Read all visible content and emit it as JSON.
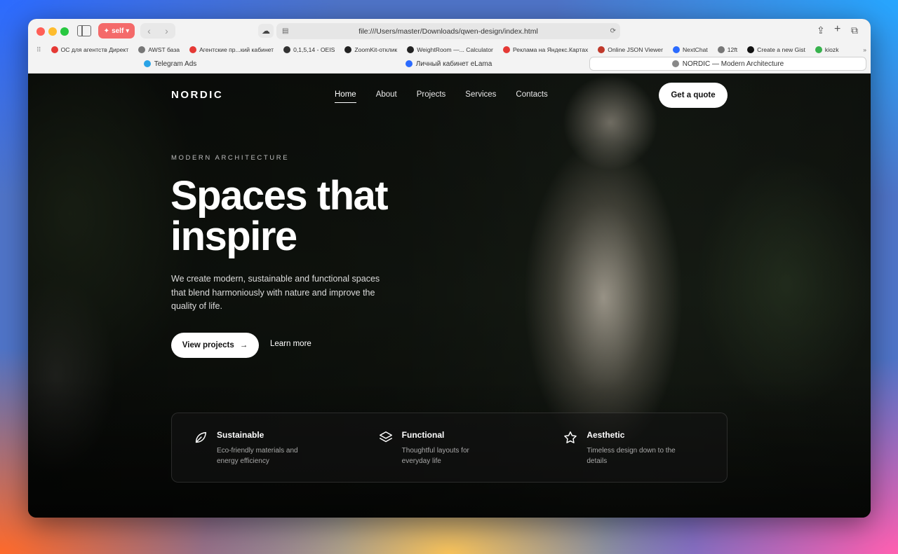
{
  "browser": {
    "profile_label": "self",
    "url": "file:///Users/master/Downloads/qwen-design/index.html",
    "bookmarks": [
      {
        "label": "ОС для агентств Директ",
        "color": "#e53935"
      },
      {
        "label": "AWST база",
        "color": "#777777"
      },
      {
        "label": "Агентские пр...кий кабинет",
        "color": "#e53935"
      },
      {
        "label": "0,1,5,14 - OEIS",
        "color": "#333333"
      },
      {
        "label": "ZoomKit-отклик",
        "color": "#222222"
      },
      {
        "label": "WeightRoom —... Calculator",
        "color": "#222222"
      },
      {
        "label": "Реклама на Яндекс.Картах",
        "color": "#e53935"
      },
      {
        "label": "Online JSON Viewer",
        "color": "#c0392b"
      },
      {
        "label": "NextChat",
        "color": "#2b6bff"
      },
      {
        "label": "12ft",
        "color": "#777777"
      },
      {
        "label": "Create a new Gist",
        "color": "#111111"
      },
      {
        "label": "kiozk",
        "color": "#37b24d"
      }
    ],
    "tabs": [
      {
        "label": "Telegram Ads",
        "color": "#2aa3e6",
        "active": false
      },
      {
        "label": "Личный кабинет eLama",
        "color": "#2b6bff",
        "active": false
      },
      {
        "label": "NORDIC — Modern Architecture",
        "color": "#888888",
        "active": true
      }
    ]
  },
  "site": {
    "logo": "NORDIC",
    "nav": [
      "Home",
      "About",
      "Projects",
      "Services",
      "Contacts"
    ],
    "quote_button": "Get a quote",
    "eyebrow": "MODERN ARCHITECTURE",
    "headline": "Spaces that inspire",
    "lead": "We create modern, sustainable and functional spaces that blend harmoniously with nature and improve the quality of life.",
    "primary_button": "View projects",
    "secondary_link": "Learn more",
    "features": [
      {
        "title": "Sustainable",
        "desc": "Eco-friendly materials and energy efficiency",
        "icon": "leaf-icon"
      },
      {
        "title": "Functional",
        "desc": "Thoughtful layouts for everyday life",
        "icon": "layers-icon"
      },
      {
        "title": "Aesthetic",
        "desc": "Timeless design down to the details",
        "icon": "star-icon"
      }
    ]
  }
}
